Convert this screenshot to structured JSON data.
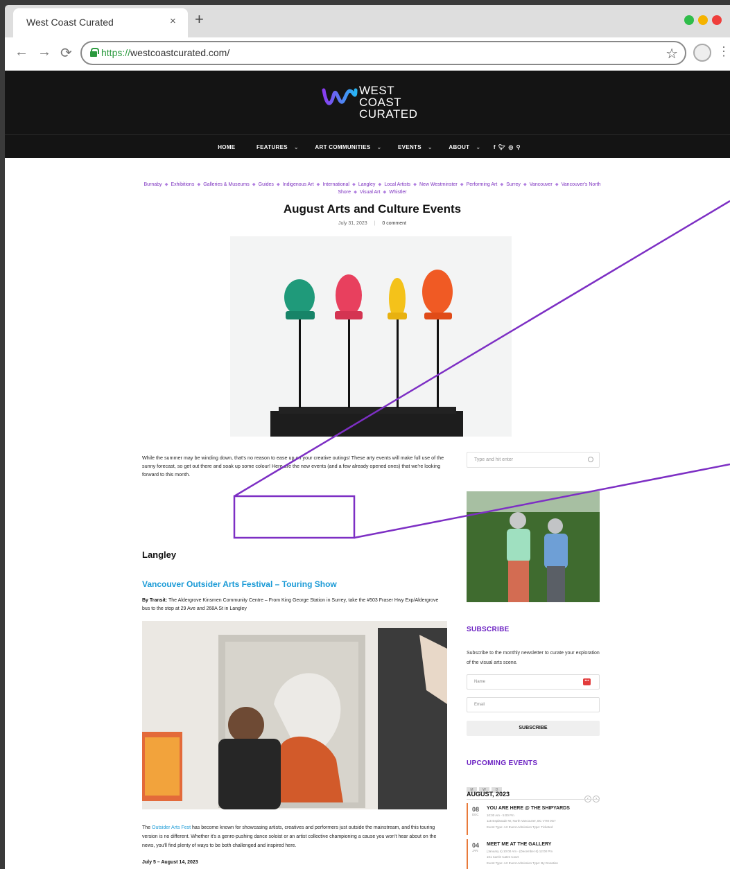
{
  "browser": {
    "tab_title": "West Coast Curated",
    "tab_close": "×",
    "new_tab": "+",
    "url_scheme": "https://",
    "url_host": "westcoastcurated.com/",
    "traffic_lights": [
      "#2fbd4a",
      "#f5b300",
      "#ef3e3b"
    ]
  },
  "site": {
    "logo_lines": [
      "WEST",
      "COAST",
      "CURATED"
    ],
    "nav": [
      {
        "label": "HOME",
        "dropdown": false
      },
      {
        "label": "FEATURES",
        "dropdown": true
      },
      {
        "label": "ART COMMUNITIES",
        "dropdown": true
      },
      {
        "label": "EVENTS",
        "dropdown": true
      },
      {
        "label": "ABOUT",
        "dropdown": true
      }
    ],
    "social": "f ✦ ◎",
    "accent": "#6a1fc2",
    "link": "#1a9ad6"
  },
  "post": {
    "categories": [
      "Burnaby",
      "Exhibitions",
      "Galleries & Museums",
      "Guides",
      "Indigenous Art",
      "International",
      "Langley",
      "Local Artists",
      "New Westminster",
      "Performing Art",
      "Surrey",
      "Vancouver",
      "Vancouver's North Shore",
      "Visual Art",
      "Whistler"
    ],
    "title": "August Arts and Culture Events",
    "date": "July 31, 2023",
    "comments": "0 comment",
    "intro": "While the summer may be winding down, that's no reason to ease up on your creative outings! These arty events will make full use of the sunny forecast, so get out there and soak up some colour! Here are the new events (and a few already opened ones) that we're looking forward to this month.",
    "section_heading": "Langley",
    "event_heading": "Vancouver Outsider Arts Festival – Touring Show",
    "transit_label": "By Transit:",
    "transit_text": "The Aldergrove Kinsmen Community Centre – From King George Station in Surrey, take the #503 Fraser Hwy Exp/Aldergrove bus to the stop at 29 Ave and 268A St in Langley",
    "body_before": "The",
    "body_link": "Outsider Arts Fest",
    "body_after": "has become known for showcasing artists, creatives and performers just outside the mainstream, and this touring version is no different. Whether it's a genre-pushing dance soloist or an artist collective championing a cause you won't hear about on the news, you'll find plenty of ways to be both challenged and inspired here.",
    "dates": "July 5 – August 14, 2023"
  },
  "sidebar": {
    "search_placeholder": "Type and hit enter",
    "subscribe_title": "SUBSCRIBE",
    "subscribe_desc": "Subscribe to the monthly newsletter to curate your exploration of the visual arts scene.",
    "name_placeholder": "Name",
    "email_placeholder": "Email",
    "subscribe_button": "SUBSCRIBE",
    "events_title": "UPCOMING EVENTS",
    "view_tabs": [
      "M",
      "W",
      "D"
    ],
    "month": "AUGUST, 2023",
    "events": [
      {
        "day": "08",
        "month": "DEC",
        "title": "YOU ARE HERE @ THE SHIPYARDS",
        "time": "10:00 Am - 5:00 Pm",
        "location": "115 Esplanade W, North Vancouver, BC V7M 0G7",
        "types": "Event Type:  Art Event   Admission Type:  Ticketed"
      },
      {
        "day": "04",
        "month": "JAN",
        "title": "MEET ME AT THE GALLERY",
        "time": "(January 4) 10:00 Am - (December 6) 12:00 Pm",
        "location": "101 Carrie Cates Court",
        "types": "Event Type:  Art Event   Admission Type:  By Donation"
      }
    ]
  }
}
